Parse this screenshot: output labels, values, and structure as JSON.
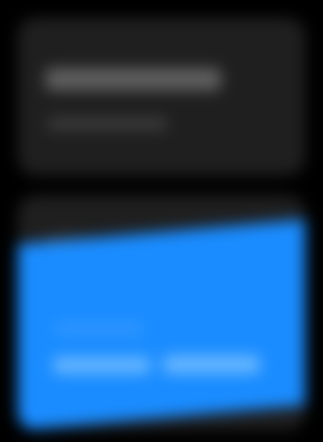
{
  "colors": {
    "background": "#000000",
    "card": "#1f1f1f",
    "accent": "#1a8cff"
  },
  "top_card": {
    "title": "",
    "subtitle": ""
  },
  "bottom_card": {
    "section_title": "",
    "panel": {
      "caption": "",
      "value_primary": "",
      "value_secondary": ""
    }
  }
}
